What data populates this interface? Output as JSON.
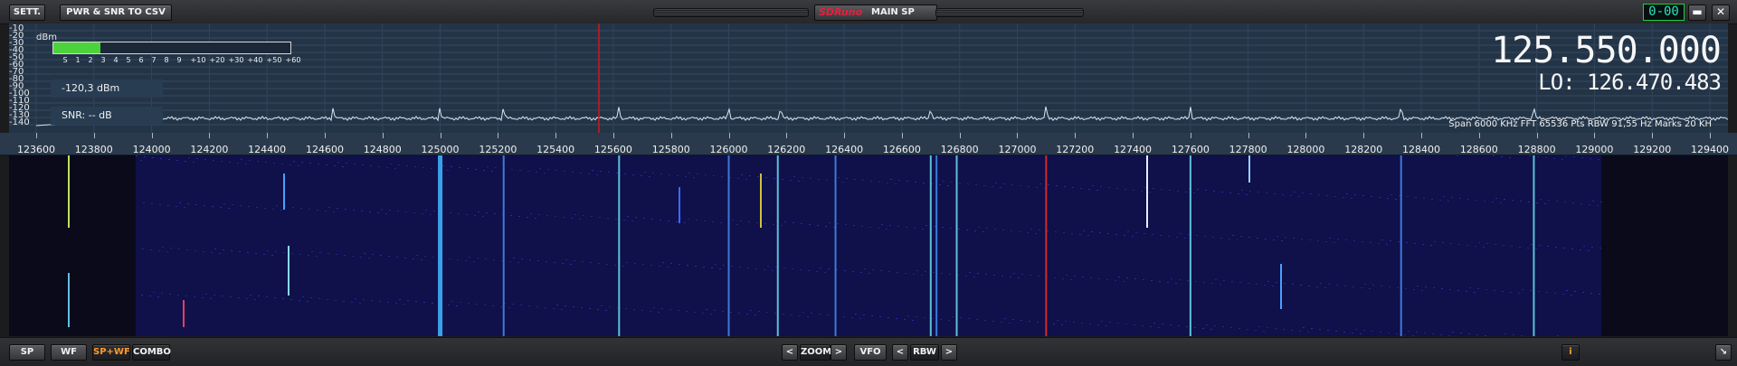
{
  "titlebar": {
    "sett_label": "SETT.",
    "csv_label": "PWR & SNR TO CSV",
    "brand_logo": "SDRuno",
    "brand_sub": "MAIN SP",
    "counter": "0-00",
    "minimize_glyph": "▬",
    "close_glyph": "✕"
  },
  "spectrum": {
    "unit": "dBm",
    "y_ticks": [
      "-10",
      "-20",
      "-30",
      "-40",
      "-50",
      "-60",
      "-70",
      "-80",
      "-90",
      "-100",
      "-110",
      "-120",
      "-130",
      "-140"
    ],
    "meter_scale": [
      "S",
      "1",
      "2",
      "3",
      "4",
      "5",
      "6",
      "7",
      "8",
      "9",
      "+10",
      "+20",
      "+30",
      "+40",
      "+50",
      "+60"
    ],
    "meter_level_fraction": 0.2,
    "power_readout": "-120,3 dBm",
    "snr_readout": "SNR: -- dB",
    "frequency": "125.550.000",
    "lo_frequency": "LO: 126.470.483",
    "info": "Span 6000 KHz   FFT 65536 Pts   RBW 91,55 Hz   Marks 20 KH",
    "x_ticks": [
      "123600",
      "123800",
      "124000",
      "124200",
      "124400",
      "124600",
      "124800",
      "125000",
      "125200",
      "125400",
      "125600",
      "125800",
      "126000",
      "126200",
      "126400",
      "126600",
      "126800",
      "127000",
      "127200",
      "127400",
      "127600",
      "127800",
      "128000",
      "128200",
      "128400",
      "128600",
      "128800",
      "129000",
      "129200",
      "129400"
    ],
    "vfo_frequency_khz": 125550,
    "colors": {
      "trace": "#d8e6f0",
      "vfo_line": "#d01818",
      "meter_fill": "#4cd33c",
      "background": "#243447"
    },
    "peaks_khz": [
      124630,
      125000,
      125220,
      125620,
      126000,
      126180,
      126700,
      127100,
      127600,
      128330,
      128790
    ]
  },
  "waterfall": {
    "signals_khz": [
      125000,
      125220,
      125620,
      126000,
      126170,
      126370,
      126700,
      126720,
      126790,
      127100,
      127600,
      128330,
      128790
    ]
  },
  "bottombar": {
    "sp_label": "SP",
    "wf_label": "WF",
    "spwf_label": "SP+WF",
    "combo_label": "COMBO",
    "zoom_prev": "<",
    "zoom_label": "ZOOM",
    "zoom_next": ">",
    "vfo_label": "VFO",
    "rbw_prev": "<",
    "rbw_label": "RBW",
    "rbw_next": ">",
    "info_label": "i",
    "resize_glyph": "↘"
  }
}
